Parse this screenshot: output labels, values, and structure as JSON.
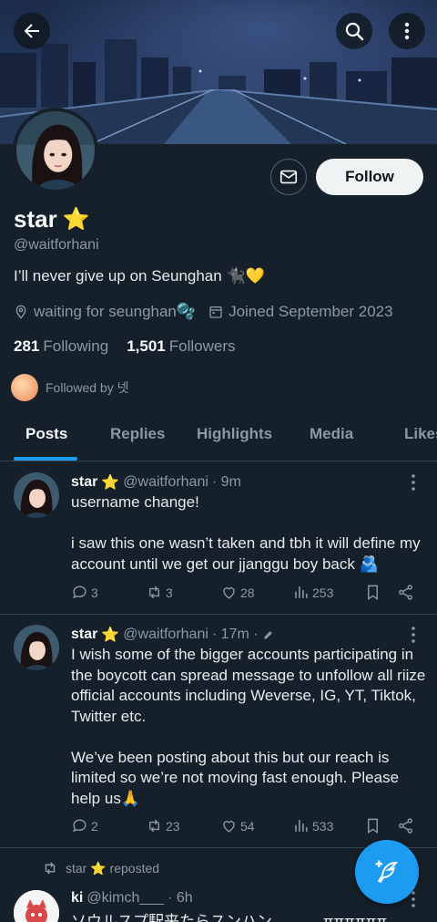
{
  "profile": {
    "name": "star",
    "name_emoji": "⭐",
    "handle": "@waitforhani",
    "bio": "I’ll never give up on Seunghan 🐈‍⬛💛",
    "location": "waiting for seunghan🫧",
    "joined": "Joined September 2023",
    "following_count": "281",
    "following_label": "Following",
    "followers_count": "1,501",
    "followers_label": "Followers",
    "followed_by": "Followed by 넷",
    "follow_button": "Follow"
  },
  "tabs": [
    {
      "label": "Posts",
      "active": true
    },
    {
      "label": "Replies"
    },
    {
      "label": "Highlights"
    },
    {
      "label": "Media"
    },
    {
      "label": "Likes"
    }
  ],
  "tweets": [
    {
      "name": "star",
      "emoji": "⭐",
      "handle": "@waitforhani",
      "time": "· 9m",
      "text": "username change!\n\ni saw this one wasn’t taken and tbh it will define my account until we get our jjanggu boy back 🫂",
      "replies": "3",
      "reposts": "3",
      "likes": "28",
      "views": "253"
    },
    {
      "name": "star",
      "emoji": "⭐",
      "handle": "@waitforhani",
      "time": "· 17m ·",
      "text": "I wish some of the bigger accounts participating in the boycott can spread message to unfollow all riize official accounts including Weverse, IG, YT, Tiktok, Twitter etc.\n\nWe’ve been posting about this but our reach is limited so we’re not moving fast enough. Please help us🙏",
      "replies": "2",
      "reposts": "23",
      "likes": "54",
      "views": "533"
    }
  ],
  "repost_line": "star ⭐ reposted",
  "tweet3": {
    "name": "ki",
    "handle": "@kimch___",
    "time": "· 6h",
    "text": "ソウルスプ駅来たらスンハン……… ππππππ"
  },
  "colors": {
    "background": "#15202b",
    "accent": "#1d9bf0",
    "secondary_text": "#8b98a5"
  }
}
